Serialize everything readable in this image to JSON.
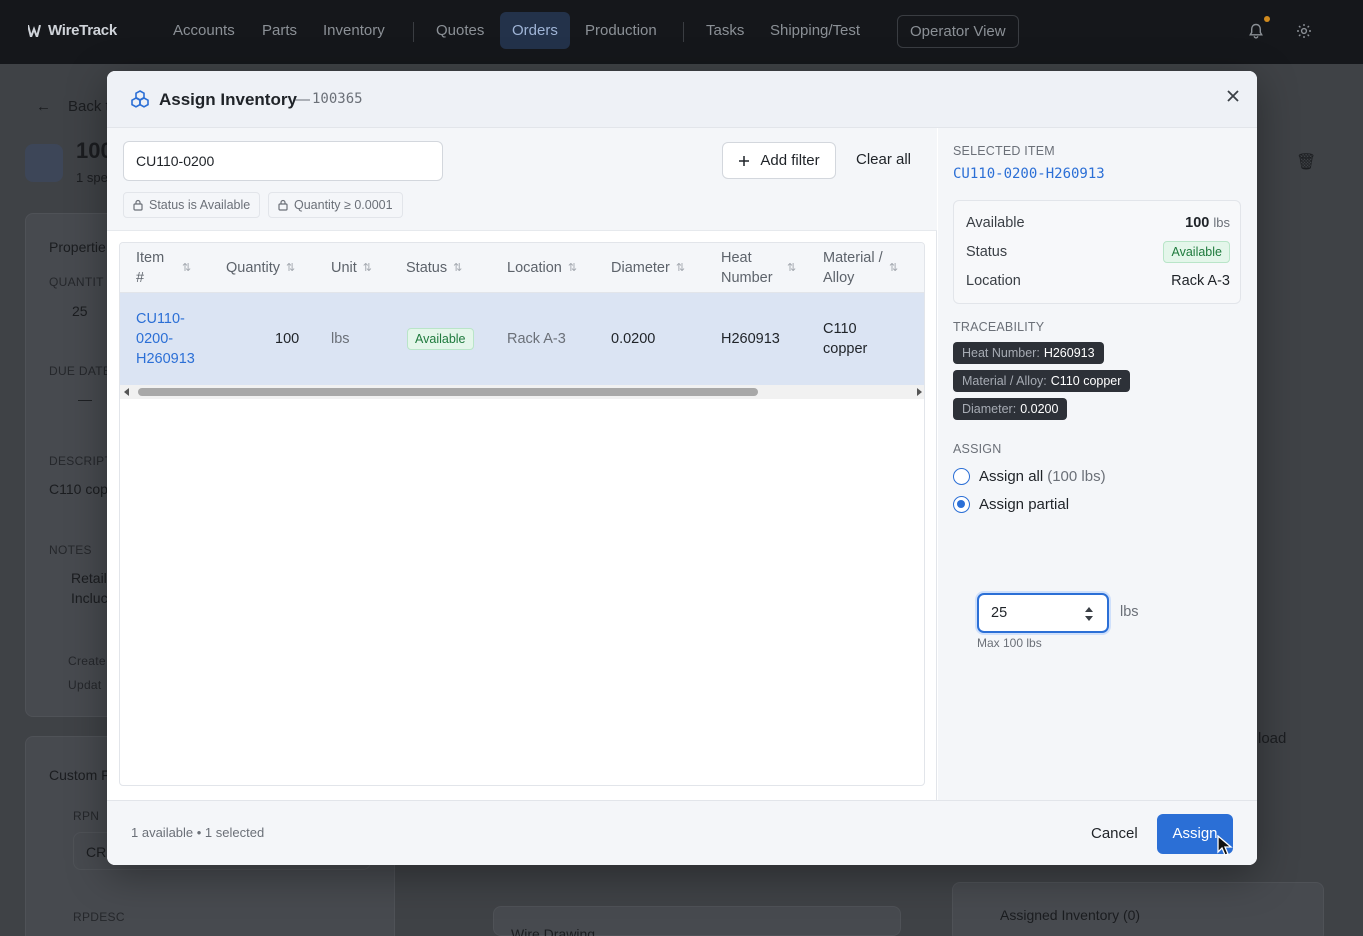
{
  "app": {
    "logo": "WireTrack",
    "nav": [
      "Accounts",
      "Parts",
      "Inventory",
      "Quotes",
      "Orders",
      "Production",
      "Tasks",
      "Shipping/Test"
    ],
    "active_nav": "Orders",
    "operator_view": "Operator View"
  },
  "background": {
    "back_link": "Back t",
    "order_prefix": "100",
    "specs_prefix": "1 spe",
    "properties_label": "Propertie",
    "quantity_label": "QUANTIT",
    "quantity_value": "25",
    "due_date_label": "DUE DATE",
    "due_date_value": "—",
    "description_label": "DESCRIPT",
    "description_value": "C110 cop",
    "notes_label": "NOTES",
    "notes_line1": "Retail",
    "notes_line2": "Incluc",
    "created_label": "Create",
    "updated_label": "Updat",
    "custom_label": "Custom F",
    "rpn_label": "RPN",
    "rpn_value": "CR",
    "rpdesc_label": "RPDESC",
    "wire_drawing": "Wire Drawing",
    "assigned_inventory": "Assigned Inventory (0)",
    "load": "load"
  },
  "modal": {
    "title": "Assign Inventory",
    "dash": "—",
    "order_id": "100365",
    "search_value": "CU110-0200",
    "add_filter": "Add filter",
    "clear_all": "Clear all",
    "chips": [
      "Status is Available",
      "Quantity ≥ 0.0001"
    ],
    "table": {
      "headers": [
        "Item #",
        "Quantity",
        "Unit",
        "Status",
        "Location",
        "Diameter",
        "Heat Number",
        "Material / Alloy"
      ],
      "rows": [
        {
          "item": "CU110-0200-H260913",
          "item_l1": "CU110-",
          "item_l2": "0200-",
          "item_l3": "H260913",
          "quantity": "100",
          "unit": "lbs",
          "status": "Available",
          "location": "Rack A-3",
          "diameter": "0.0200",
          "heat": "H260913",
          "material_l1": "C110",
          "material_l2": "copper"
        }
      ]
    },
    "selected": {
      "label": "SELECTED ITEM",
      "id": "CU110-0200-H260913",
      "available_label": "Available",
      "available_value": "100",
      "available_unit": "lbs",
      "status_label": "Status",
      "status_value": "Available",
      "location_label": "Location",
      "location_value": "Rack A-3"
    },
    "traceability": {
      "label": "TRACEABILITY",
      "tags": [
        {
          "key": "Heat Number:",
          "value": "H260913"
        },
        {
          "key": "Material / Alloy:",
          "value": "C110 copper"
        },
        {
          "key": "Diameter:",
          "value": "0.0200"
        }
      ]
    },
    "assign": {
      "label": "ASSIGN",
      "all_label": "Assign all",
      "all_hint": "(100 lbs)",
      "partial_label": "Assign partial",
      "selected_option": "partial",
      "qty_value": "25",
      "qty_unit": "lbs",
      "max_text": "Max 100 lbs"
    },
    "footer": {
      "status": "1 available • 1 selected",
      "cancel": "Cancel",
      "assign": "Assign"
    }
  },
  "colors": {
    "accent": "#2b6fd6",
    "badge_bg": "#e4f6ea",
    "badge_text": "#1f7a3d",
    "row_selected": "#dbe4f3"
  }
}
